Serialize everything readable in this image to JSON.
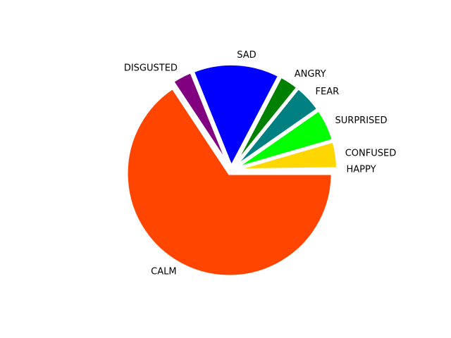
{
  "chart_data": {
    "type": "pie",
    "title": "",
    "start_angle_deg": 0,
    "direction": "counterclockwise",
    "exploded": true,
    "slices": [
      {
        "label": "HAPPY",
        "value": 0.2,
        "color": "#FFD700"
      },
      {
        "label": "CONFUSED",
        "value": 4.3,
        "color": "#FFD700"
      },
      {
        "label": "SURPRISED",
        "value": 5.2,
        "color": "#00FF00"
      },
      {
        "label": "FEAR",
        "value": 4.5,
        "color": "#008080"
      },
      {
        "label": "ANGRY",
        "value": 3.1,
        "color": "#008000"
      },
      {
        "label": "SAD",
        "value": 13.8,
        "color": "#0000FF"
      },
      {
        "label": "DISGUSTED",
        "value": 3.2,
        "color": "#800080"
      },
      {
        "label": "CALM",
        "value": 65.7,
        "color": "#FF4500"
      }
    ]
  }
}
